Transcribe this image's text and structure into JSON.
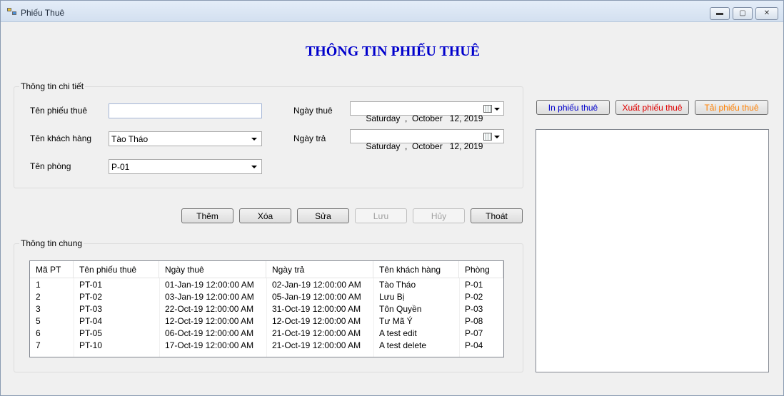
{
  "window": {
    "title": "Phiếu Thuê"
  },
  "header": {
    "title": "THÔNG TIN PHIẾU THUÊ"
  },
  "details": {
    "group_label": "Thông tin chi tiết",
    "ten_phieu_label": "Tên phiếu thuê",
    "ten_phieu_value": "",
    "khach_hang_label": "Tên khách hàng",
    "khach_hang_value": "Tào Tháo",
    "phong_label": "Tên phòng",
    "phong_value": "P-01",
    "ngay_thue_label": "Ngày thuê",
    "ngay_thue_value": "Saturday  ,  October   12, 2019",
    "ngay_tra_label": "Ngày trả",
    "ngay_tra_value": "Saturday  ,  October   12, 2019"
  },
  "actions": {
    "them": "Thêm",
    "xoa": "Xóa",
    "sua": "Sửa",
    "luu": "Lưu",
    "huy": "Hủy",
    "thoat": "Thoát"
  },
  "print_actions": {
    "in": "In phiếu thuê",
    "xuat": "Xuất phiếu thuê",
    "tai": "Tải phiếu thuê"
  },
  "colors": {
    "title": "#0000cc",
    "in_button": "#0000cc",
    "xuat_button": "#e00000",
    "tai_button": "#ff8000"
  },
  "general": {
    "group_label": "Thông tin chung",
    "columns": [
      "Mã PT",
      "Tên phiếu thuê",
      "Ngày thuê",
      "Ngày trả",
      "Tên khách hàng",
      "Phòng"
    ],
    "rows": [
      [
        "1",
        "PT-01",
        "01-Jan-19 12:00:00 AM",
        "02-Jan-19 12:00:00 AM",
        "Tào Tháo",
        "P-01"
      ],
      [
        "2",
        "PT-02",
        "03-Jan-19 12:00:00 AM",
        "05-Jan-19 12:00:00 AM",
        "Lưu Bị",
        "P-02"
      ],
      [
        "3",
        "PT-03",
        "22-Oct-19 12:00:00 AM",
        "31-Oct-19 12:00:00 AM",
        "Tôn Quyền",
        "P-03"
      ],
      [
        "5",
        "PT-04",
        "12-Oct-19 12:00:00 AM",
        "12-Oct-19 12:00:00 AM",
        "Tư Mã Ý",
        "P-08"
      ],
      [
        "6",
        "PT-05",
        "06-Oct-19 12:00:00 AM",
        "21-Oct-19 12:00:00 AM",
        "A test edit",
        "P-07"
      ],
      [
        "7",
        "PT-10",
        "17-Oct-19 12:00:00 AM",
        "21-Oct-19 12:00:00 AM",
        "A test delete",
        "P-04"
      ]
    ]
  }
}
